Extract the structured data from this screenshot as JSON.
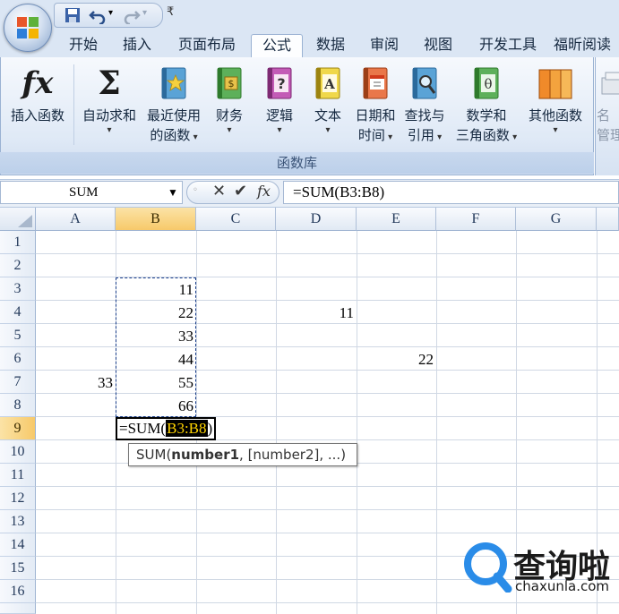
{
  "quick_access": {
    "more": "₹"
  },
  "tabs": [
    {
      "label": "开始"
    },
    {
      "label": "插入"
    },
    {
      "label": "页面布局"
    },
    {
      "label": "公式",
      "active": true
    },
    {
      "label": "数据"
    },
    {
      "label": "审阅"
    },
    {
      "label": "视图"
    },
    {
      "label": "开发工具"
    },
    {
      "label": "福昕阅读"
    }
  ],
  "ribbon": {
    "group_label": "函数库",
    "buttons": [
      {
        "line1": "插入函数",
        "line2": "",
        "icon": "fx-icon"
      },
      {
        "line1": "自动求和",
        "line2": "",
        "icon": "sigma-icon"
      },
      {
        "line1": "最近使用",
        "line2": "的函数",
        "icon": "recent-book-icon"
      },
      {
        "line1": "财务",
        "line2": "",
        "icon": "finance-book-icon"
      },
      {
        "line1": "逻辑",
        "line2": "",
        "icon": "logic-book-icon"
      },
      {
        "line1": "文本",
        "line2": "",
        "icon": "text-book-icon"
      },
      {
        "line1": "日期和",
        "line2": "时间",
        "icon": "date-book-icon"
      },
      {
        "line1": "查找与",
        "line2": "引用",
        "icon": "lookup-book-icon"
      },
      {
        "line1": "数学和",
        "line2": "三角函数",
        "icon": "math-book-icon"
      },
      {
        "line1": "其他函数",
        "line2": "",
        "icon": "more-books-icon"
      },
      {
        "line1": "名",
        "line2": "管理",
        "icon": "name-manager-icon"
      }
    ]
  },
  "formula_bar": {
    "name_box": "SUM",
    "formula": "=SUM(B3:B8)"
  },
  "columns": [
    "A",
    "B",
    "C",
    "D",
    "E",
    "F",
    "G"
  ],
  "selected_column": "B",
  "rows": [
    "1",
    "2",
    "3",
    "4",
    "5",
    "6",
    "7",
    "8",
    "9",
    "10",
    "11",
    "12",
    "13",
    "14",
    "15",
    "16"
  ],
  "selected_row": "9",
  "cells": [
    {
      "ref": "B3",
      "value": "11"
    },
    {
      "ref": "B4",
      "value": "22"
    },
    {
      "ref": "D4",
      "value": "11"
    },
    {
      "ref": "B5",
      "value": "33"
    },
    {
      "ref": "B6",
      "value": "44"
    },
    {
      "ref": "E6",
      "value": "22"
    },
    {
      "ref": "A7",
      "value": "33"
    },
    {
      "ref": "B7",
      "value": "55"
    },
    {
      "ref": "B8",
      "value": "66"
    }
  ],
  "edit_cell": {
    "prefix": "=SUM(",
    "ref": "B3:B8",
    "suffix": ")"
  },
  "tooltip": {
    "func": "SUM(",
    "arg1": "number1",
    "rest": ", [number2], ...)"
  },
  "watermark": {
    "text": "查询啦",
    "url": "chaxunla.com"
  },
  "colors": {
    "accent": "#1f4e9c",
    "selection": "#f7c96a",
    "watermark_blue": "#2a8ce8"
  }
}
